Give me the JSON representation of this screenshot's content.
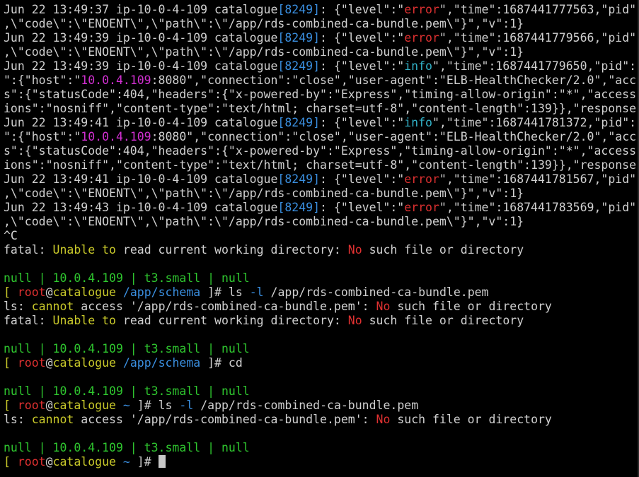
{
  "colors": {
    "default": "#d0d0d0",
    "green": "#2fc72f",
    "yellow": "#c9c92a",
    "red": "#e03131",
    "blue": "#3a8fe0",
    "cyan": "#32b2c8",
    "magenta": "#d12fd1",
    "cursor": "#c8c8c8"
  },
  "terminal": {
    "lines": [
      [
        [
          "d",
          "Jun 22 13:49:37 ip-10-0-4-109 catalogue"
        ],
        [
          "b",
          "[8249]"
        ],
        [
          "d",
          ": {\"level\":\""
        ],
        [
          "r",
          "error"
        ],
        [
          "d",
          "\",\"time\":1687441777563,\"pid\""
        ]
      ],
      [
        [
          "d",
          ",\\\"code\\\":\\\"ENOENT\\\",\\\"path\\\":\\\"/app/rds-combined-ca-bundle.pem\\\"}\",\"v\":1}"
        ]
      ],
      [
        [
          "d",
          "Jun 22 13:49:39 ip-10-0-4-109 catalogue"
        ],
        [
          "b",
          "[8249]"
        ],
        [
          "d",
          ": {\"level\":\""
        ],
        [
          "r",
          "error"
        ],
        [
          "d",
          "\",\"time\":1687441779566,\"pid\""
        ]
      ],
      [
        [
          "d",
          ",\\\"code\\\":\\\"ENOENT\\\",\\\"path\\\":\\\"/app/rds-combined-ca-bundle.pem\\\"}\",\"v\":1}"
        ]
      ],
      [
        [
          "d",
          "Jun 22 13:49:39 ip-10-0-4-109 catalogue"
        ],
        [
          "b",
          "[8249]"
        ],
        [
          "d",
          ": {\"level\":\""
        ],
        [
          "c",
          "info"
        ],
        [
          "d",
          "\",\"time\":1687441779650,\"pid\":"
        ]
      ],
      [
        [
          "d",
          "\":{\"host\":\""
        ],
        [
          "m",
          "10.0.4.109"
        ],
        [
          "d",
          ":8080\",\"connection\":\"close\",\"user-agent\":\"ELB-HealthChecker/2.0\",\"acc"
        ]
      ],
      [
        [
          "d",
          "s\":{\"statusCode\":404,\"headers\":{\"x-powered-by\":\"Express\",\"timing-allow-origin\":\"*\",\"access"
        ]
      ],
      [
        [
          "d",
          "ions\":\"nosniff\",\"content-type\":\"text/html; charset=utf-8\",\"content-length\":139}},\"response"
        ]
      ],
      [
        [
          "d",
          "Jun 22 13:49:41 ip-10-0-4-109 catalogue"
        ],
        [
          "b",
          "[8249]"
        ],
        [
          "d",
          ": {\"level\":\""
        ],
        [
          "c",
          "info"
        ],
        [
          "d",
          "\",\"time\":1687441781372,\"pid\":"
        ]
      ],
      [
        [
          "d",
          "\":{\"host\":\""
        ],
        [
          "m",
          "10.0.4.109"
        ],
        [
          "d",
          ":8080\",\"connection\":\"close\",\"user-agent\":\"ELB-HealthChecker/2.0\",\"acc"
        ]
      ],
      [
        [
          "d",
          "s\":{\"statusCode\":404,\"headers\":{\"x-powered-by\":\"Express\",\"timing-allow-origin\":\"*\",\"access"
        ]
      ],
      [
        [
          "d",
          "ions\":\"nosniff\",\"content-type\":\"text/html; charset=utf-8\",\"content-length\":139}},\"response"
        ]
      ],
      [
        [
          "d",
          "Jun 22 13:49:41 ip-10-0-4-109 catalogue"
        ],
        [
          "b",
          "[8249]"
        ],
        [
          "d",
          ": {\"level\":\""
        ],
        [
          "r",
          "error"
        ],
        [
          "d",
          "\",\"time\":1687441781567,\"pid\""
        ]
      ],
      [
        [
          "d",
          ",\\\"code\\\":\\\"ENOENT\\\",\\\"path\\\":\\\"/app/rds-combined-ca-bundle.pem\\\"}\",\"v\":1}"
        ]
      ],
      [
        [
          "d",
          "Jun 22 13:49:43 ip-10-0-4-109 catalogue"
        ],
        [
          "b",
          "[8249]"
        ],
        [
          "d",
          ": {\"level\":\""
        ],
        [
          "r",
          "error"
        ],
        [
          "d",
          "\",\"time\":1687441783569,\"pid\""
        ]
      ],
      [
        [
          "d",
          ",\\\"code\\\":\\\"ENOENT\\\",\\\"path\\\":\\\"/app/rds-combined-ca-bundle.pem\\\"}\",\"v\":1}"
        ]
      ],
      [
        [
          "d",
          "^C"
        ]
      ],
      [
        [
          "d",
          "fatal: "
        ],
        [
          "y",
          "Unable to"
        ],
        [
          "d",
          " read current working directory: "
        ],
        [
          "r",
          "No"
        ],
        [
          "d",
          " such file or directory"
        ]
      ],
      [],
      [
        [
          "g",
          "null | 10.0.4.109 | t3.small | null"
        ]
      ],
      [
        [
          "y",
          "[ "
        ],
        [
          "r",
          "root"
        ],
        [
          "d",
          "@"
        ],
        [
          "y",
          "catalogue"
        ],
        [
          "d",
          " "
        ],
        [
          "b",
          "/app/schema"
        ],
        [
          "d",
          " ]# ls "
        ],
        [
          "b",
          "-l"
        ],
        [
          "d",
          " /app/rds-combined-ca-bundle.pem"
        ]
      ],
      [
        [
          "d",
          "ls: "
        ],
        [
          "y",
          "cannot"
        ],
        [
          "d",
          " access '/app/rds-combined-ca-bundle.pem': "
        ],
        [
          "r",
          "No"
        ],
        [
          "d",
          " such file or directory"
        ]
      ],
      [
        [
          "d",
          "fatal: "
        ],
        [
          "y",
          "Unable to"
        ],
        [
          "d",
          " read current working directory: "
        ],
        [
          "r",
          "No"
        ],
        [
          "d",
          " such file or directory"
        ]
      ],
      [],
      [
        [
          "g",
          "null | 10.0.4.109 | t3.small | null"
        ]
      ],
      [
        [
          "y",
          "[ "
        ],
        [
          "r",
          "root"
        ],
        [
          "d",
          "@"
        ],
        [
          "y",
          "catalogue"
        ],
        [
          "d",
          " "
        ],
        [
          "b",
          "/app/schema"
        ],
        [
          "d",
          " ]# cd"
        ]
      ],
      [],
      [
        [
          "g",
          "null | 10.0.4.109 | t3.small | null"
        ]
      ],
      [
        [
          "y",
          "[ "
        ],
        [
          "r",
          "root"
        ],
        [
          "d",
          "@"
        ],
        [
          "y",
          "catalogue"
        ],
        [
          "d",
          " "
        ],
        [
          "b",
          "~"
        ],
        [
          "d",
          " ]# ls "
        ],
        [
          "b",
          "-l"
        ],
        [
          "d",
          " /app/rds-combined-ca-bundle.pem"
        ]
      ],
      [
        [
          "d",
          "ls: "
        ],
        [
          "y",
          "cannot"
        ],
        [
          "d",
          " access '/app/rds-combined-ca-bundle.pem': "
        ],
        [
          "r",
          "No"
        ],
        [
          "d",
          " such file or directory"
        ]
      ],
      [],
      [
        [
          "g",
          "null | 10.0.4.109 | t3.small | null"
        ]
      ],
      [
        [
          "y",
          "[ "
        ],
        [
          "r",
          "root"
        ],
        [
          "d",
          "@"
        ],
        [
          "y",
          "catalogue"
        ],
        [
          "d",
          " "
        ],
        [
          "b",
          "~"
        ],
        [
          "d",
          " ]# "
        ]
      ]
    ]
  }
}
